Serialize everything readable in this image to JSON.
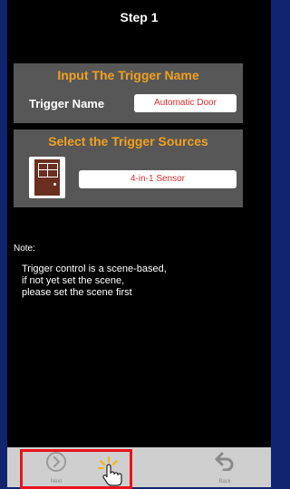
{
  "header": {
    "title": "Step 1"
  },
  "trigger_name_section": {
    "heading": "Input The Trigger Name",
    "field_label": "Trigger Name",
    "field_value": "Automatic Door"
  },
  "trigger_source_section": {
    "heading": "Select the Trigger Sources",
    "icon": "door-icon",
    "selected_source": "4-in-1 Sensor"
  },
  "note": {
    "label": "Note:",
    "lines": [
      "Trigger control is a scene-based,",
      "if not yet set the scene,",
      "please set the scene first"
    ]
  },
  "bottom_bar": {
    "next_label": "Next",
    "back_label": "Back",
    "next_icon": "chevron-right-circle-icon",
    "back_icon": "back-arrow-icon"
  },
  "colors": {
    "background": "#000000",
    "outer_frame": "#11246f",
    "panel": "#575757",
    "heading": "#f0a020",
    "field_text": "#e02a2a",
    "highlight": "#e8141c",
    "bottom_bar": "#cfcfcf"
  }
}
